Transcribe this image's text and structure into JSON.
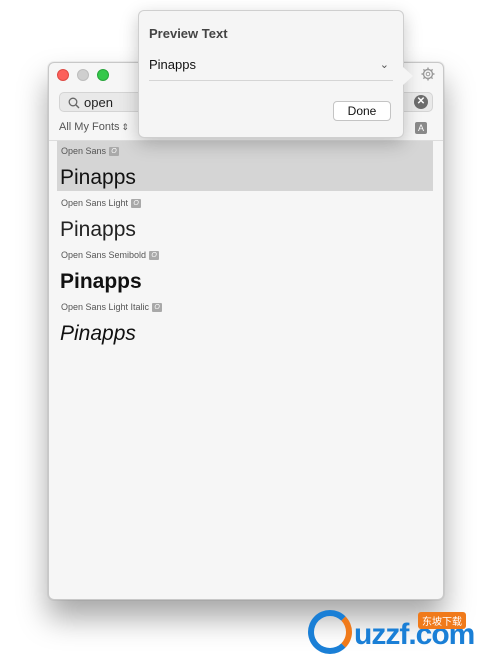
{
  "popover": {
    "title": "Preview Text",
    "selected_value": "Pinapps",
    "done_label": "Done"
  },
  "search": {
    "value": "open"
  },
  "filter": {
    "label": "All My Fonts"
  },
  "icons": {
    "gear": "gear-icon",
    "search": "magnifier-icon",
    "clear": "clear-icon",
    "font_size": "A"
  },
  "fonts": [
    {
      "name": "Open Sans",
      "preview": "Pinapps",
      "badge": "O"
    },
    {
      "name": "Open Sans Light",
      "preview": "Pinapps",
      "badge": "O"
    },
    {
      "name": "Open Sans Semibold",
      "preview": "Pinapps",
      "badge": "O"
    },
    {
      "name": "Open Sans Light Italic",
      "preview": "Pinapps",
      "badge": "O"
    }
  ],
  "watermark": {
    "text": "uzzf.com",
    "tag": "东坡下载"
  },
  "colors": {
    "selection": "#d5d5d5",
    "close": "#fc605b",
    "zoom": "#34c84a"
  }
}
